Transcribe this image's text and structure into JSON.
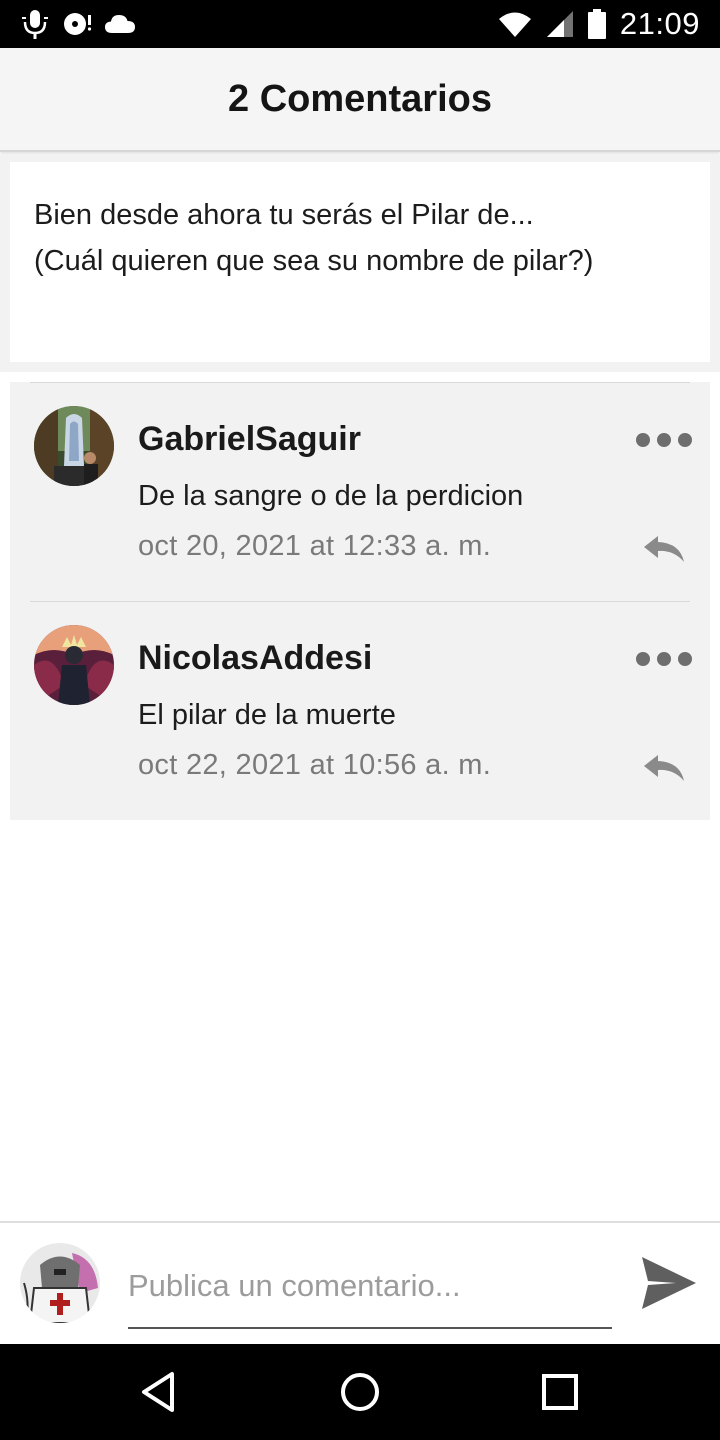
{
  "status_bar": {
    "time": "21:09",
    "icons": [
      "microphone-icon",
      "cd-icon",
      "cloud-icon",
      "wifi-icon",
      "signal-icon",
      "battery-icon"
    ]
  },
  "header": {
    "title": "2 Comentarios"
  },
  "post": {
    "line1": "Bien desde ahora tu serás el Pilar de...",
    "line2": "(Cuál quieren que sea su nombre de pilar?)"
  },
  "comments": [
    {
      "author": "GabrielSaguir",
      "text": "De la sangre o de la perdicion",
      "date": "oct 20, 2021 at 12:33 a. m."
    },
    {
      "author": "NicolasAddesi",
      "text": "El pilar de la muerte",
      "date": "oct 22, 2021 at 10:56 a. m."
    }
  ],
  "composer": {
    "placeholder": "Publica un comentario..."
  },
  "nav_bar": {
    "icons": [
      "back-icon",
      "home-icon",
      "recents-icon"
    ]
  },
  "colors": {
    "header_bg": "#f5f5f5",
    "comment_bg": "#f2f2f2",
    "muted_text": "#7a7a7a",
    "system_bar": "#000000"
  }
}
